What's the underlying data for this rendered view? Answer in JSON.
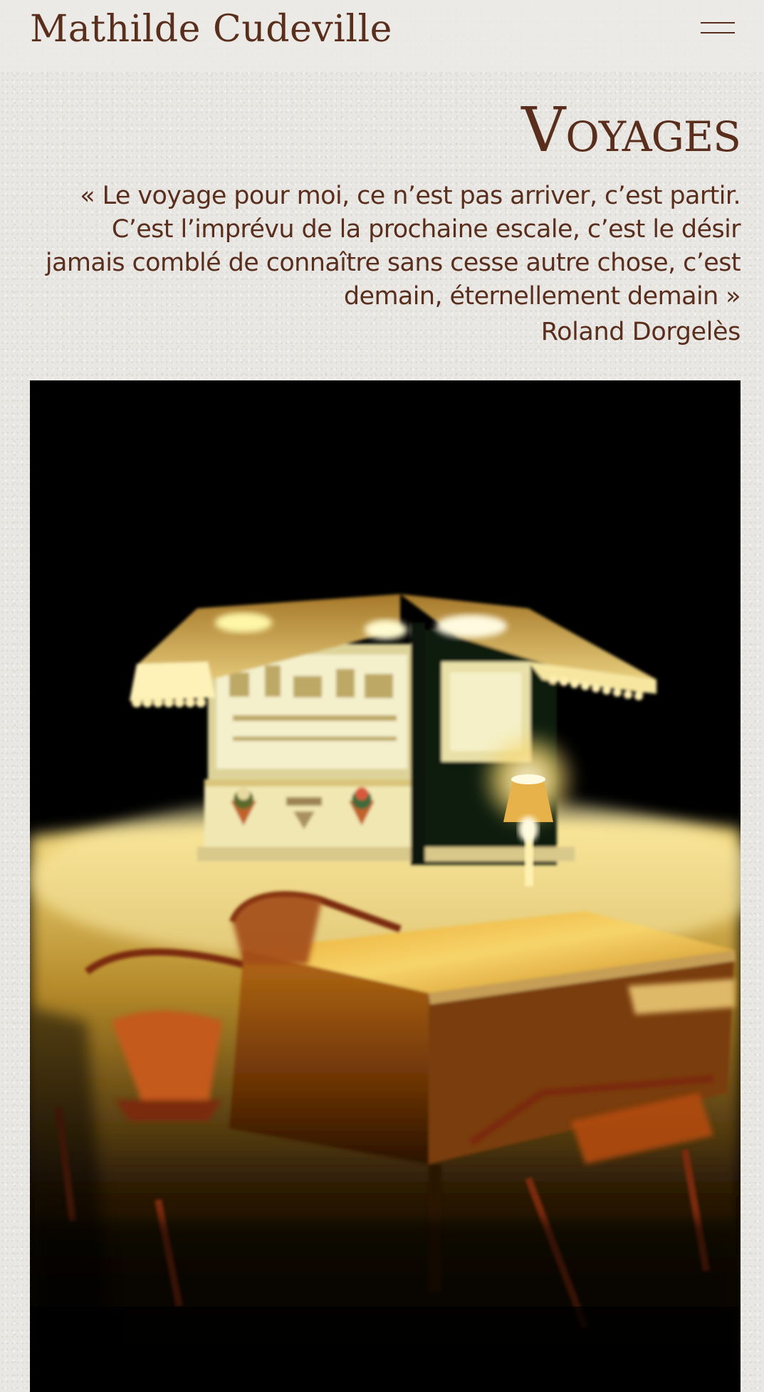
{
  "header": {
    "site_title": "Mathilde Cudeville",
    "menu_icon": "hamburger-menu-icon"
  },
  "page": {
    "heading_first_letter": "V",
    "heading_rest": "oyages"
  },
  "quote": {
    "text": "« Le voyage pour moi, ce n’est pas arriver, c’est partir. C’est l’imprévu de la prochaine escale, c’est le désir jamais comblé de connaître sans cesse autre chose, c’est demain, éternellement demain »",
    "author": "Roland Dorgelès"
  },
  "photo": {
    "subject": "night-kiosk-cafe-table-photo"
  },
  "colors": {
    "background": "#e9e7e3",
    "text_brown": "#5a2e1c",
    "photo_black": "#000000"
  }
}
